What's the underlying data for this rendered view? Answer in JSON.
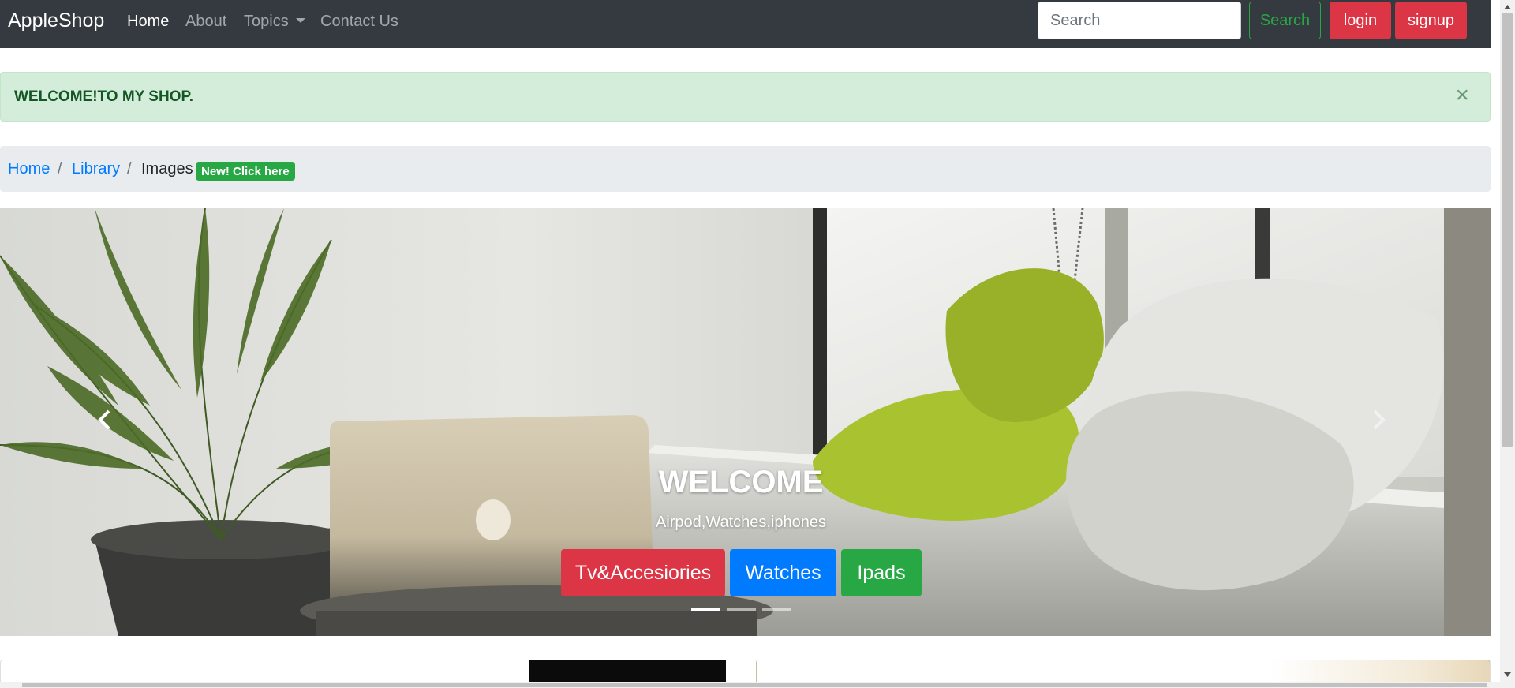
{
  "navbar": {
    "brand": "AppleShop",
    "links": [
      {
        "label": "Home",
        "active": true
      },
      {
        "label": "About",
        "active": false
      },
      {
        "label": "Topics",
        "active": false,
        "dropdown": true
      },
      {
        "label": "Contact Us",
        "active": false
      }
    ],
    "search_placeholder": "Search",
    "search_button": "Search",
    "login_button": "login",
    "signup_button": "signup"
  },
  "alert": {
    "text": "WELCOME!TO MY SHOP.",
    "close_symbol": "×"
  },
  "breadcrumb": {
    "items": [
      "Home",
      "Library",
      "Images"
    ],
    "separator": "/",
    "badge": "New! Click here"
  },
  "carousel": {
    "caption_title": "WELCOME",
    "caption_subtitle": "Airpod,Watches,iphones",
    "buttons": [
      "Tv&Accesiories",
      "Watches",
      "Ipads"
    ],
    "indicator_count": 3,
    "active_indicator": 0,
    "prev_icon": "chevron-left-icon",
    "next_icon": "chevron-right-icon"
  },
  "colors": {
    "navbar_bg": "#343a40",
    "danger": "#dc3545",
    "primary": "#007bff",
    "success": "#28a745",
    "alert_bg": "#d4edda",
    "breadcrumb_bg": "#e9ecef"
  }
}
